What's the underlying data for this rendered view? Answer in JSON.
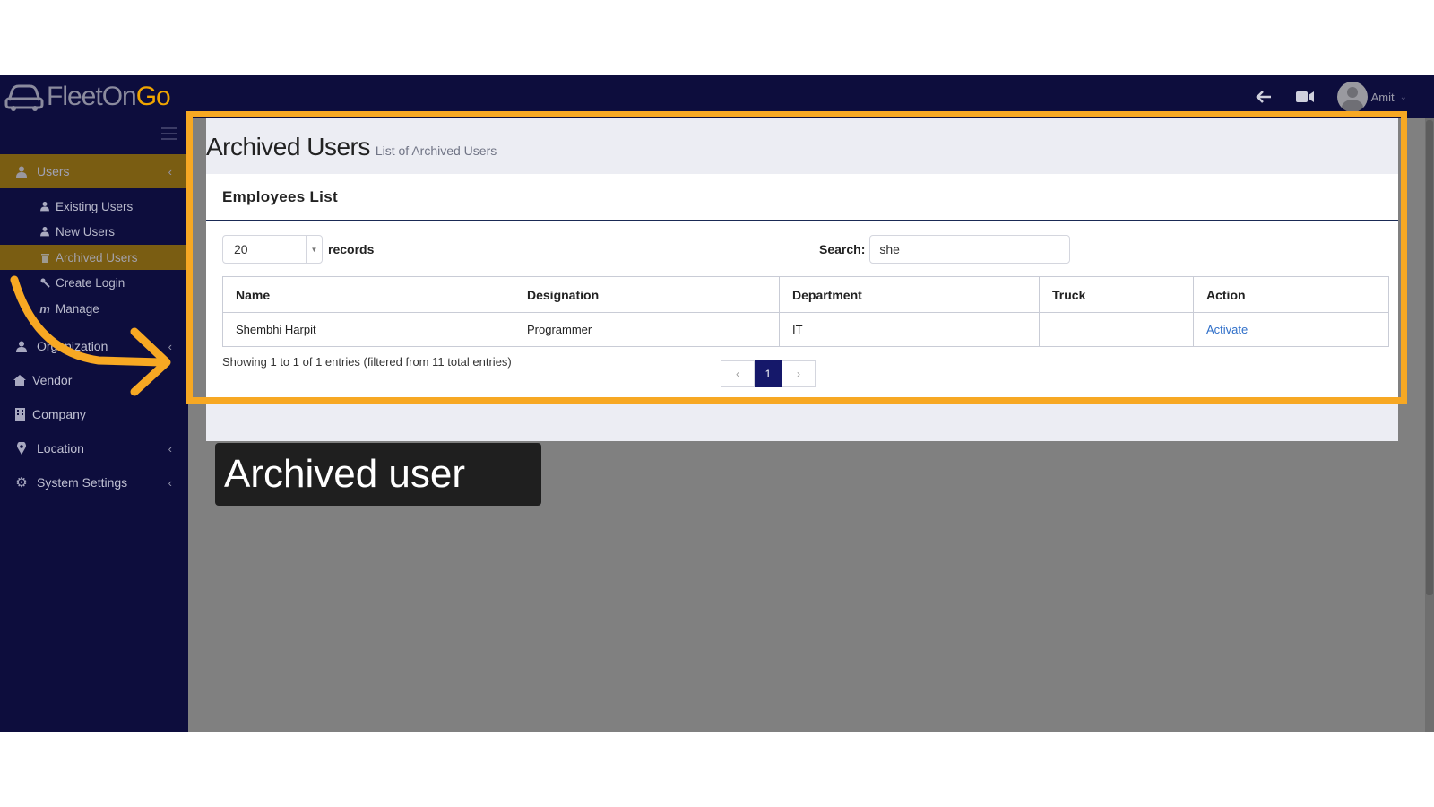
{
  "brand": {
    "name_part1": "FleetOn",
    "name_part2": "Go"
  },
  "header": {
    "user_name": "Amit"
  },
  "sidebar": {
    "items": [
      {
        "label": "Users",
        "icon": "user-icon"
      },
      {
        "label": "Organization",
        "icon": "user-icon"
      },
      {
        "label": "Vendor",
        "icon": "home-icon"
      },
      {
        "label": "Company",
        "icon": "building-icon"
      },
      {
        "label": "Location",
        "icon": "map-pin-icon"
      },
      {
        "label": "System Settings",
        "icon": "gear-icon"
      }
    ],
    "sub_items": [
      {
        "label": "Existing Users",
        "icon": "user-icon"
      },
      {
        "label": "New Users",
        "icon": "user-icon"
      },
      {
        "label": "Archived Users",
        "icon": "trash-icon"
      },
      {
        "label": "Create Login",
        "icon": "key-icon"
      },
      {
        "label": "Manage",
        "icon": "m-icon"
      }
    ]
  },
  "page": {
    "title": "Archived Users",
    "subtitle": "List of Archived Users"
  },
  "box": {
    "title": "Employees List"
  },
  "records": {
    "value": "20",
    "label": "records"
  },
  "search": {
    "label": "Search:",
    "value": "she"
  },
  "table": {
    "headers": [
      "Name",
      "Designation",
      "Department",
      "Truck",
      "Action"
    ],
    "rows": [
      {
        "name": "Shembhi Harpit",
        "designation": "Programmer",
        "department": "IT",
        "truck": "",
        "action": "Activate"
      }
    ]
  },
  "info": "Showing 1 to 1 of 1 entries (filtered from 11 total entries)",
  "pager": {
    "prev": "‹",
    "current": "1",
    "next": "›"
  },
  "caption": "Archived user",
  "colors": {
    "navy": "#0d0d3d",
    "active": "#7a5d12",
    "highlight": "#f7a823",
    "page_active": "#15186a",
    "link": "#2f6fc9"
  }
}
